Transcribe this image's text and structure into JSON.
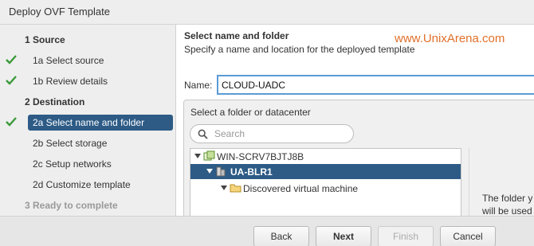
{
  "window": {
    "title": "Deploy OVF Template"
  },
  "steps": [
    {
      "label": "1  Source",
      "state": "header",
      "checked": false
    },
    {
      "label": "1a  Select source",
      "state": "done",
      "checked": true
    },
    {
      "label": "1b  Review details",
      "state": "done",
      "checked": true
    },
    {
      "label": "2  Destination",
      "state": "header",
      "checked": false
    },
    {
      "label": "2a  Select name and folder",
      "state": "active",
      "checked": true
    },
    {
      "label": "2b  Select storage",
      "state": "pending",
      "checked": false
    },
    {
      "label": "2c  Setup networks",
      "state": "pending",
      "checked": false
    },
    {
      "label": "2d  Customize template",
      "state": "pending",
      "checked": false
    },
    {
      "label": "3  Ready to complete",
      "state": "disabled",
      "checked": false
    }
  ],
  "main": {
    "heading": "Select name and folder",
    "subheading": "Specify a name and location for the deployed template",
    "watermark": "www.UnixArena.com",
    "name_label": "Name:",
    "name_value": "CLOUD-UADC",
    "folder_panel_title": "Select a folder or datacenter",
    "search_placeholder": "Search",
    "tree": [
      {
        "label": "WIN-SCRV7BJTJ8B",
        "icon": "vcenter-icon",
        "selected": false
      },
      {
        "label": "UA-BLR1",
        "icon": "datacenter-icon",
        "selected": true
      },
      {
        "label": "Discovered virtual machine",
        "icon": "folder-icon",
        "selected": false
      }
    ],
    "info_text": "The folder y\nwill be used"
  },
  "buttons": {
    "back": "Back",
    "next": "Next",
    "finish": "Finish",
    "cancel": "Cancel"
  },
  "colors": {
    "accent": "#2d5b86",
    "check": "#3a9a3a",
    "watermark": "#e0702a",
    "focus": "#5b9bd5"
  }
}
